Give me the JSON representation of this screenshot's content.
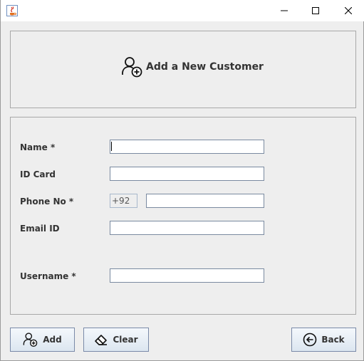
{
  "window": {
    "controls": {
      "minimize_icon": "minimize-icon",
      "maximize_icon": "maximize-icon",
      "close_icon": "close-icon"
    }
  },
  "header": {
    "title": "Add a New Customer",
    "icon": "add-user-icon"
  },
  "form": {
    "fields": [
      {
        "label": "Name *",
        "value": ""
      },
      {
        "label": "ID Card",
        "value": ""
      },
      {
        "label": "Phone No *",
        "prefix": "+92",
        "value": ""
      },
      {
        "label": "Email ID",
        "value": ""
      },
      {
        "label": "Username *",
        "value": ""
      }
    ]
  },
  "buttons": {
    "add": {
      "label": "Add",
      "icon": "add-user-icon"
    },
    "clear": {
      "label": "Clear",
      "icon": "eraser-icon"
    },
    "back": {
      "label": "Back",
      "icon": "back-arrow-icon"
    }
  },
  "colors": {
    "background": "#eeeeee",
    "field_border": "#7a8aa0",
    "button_border": "#7a8aa8"
  }
}
